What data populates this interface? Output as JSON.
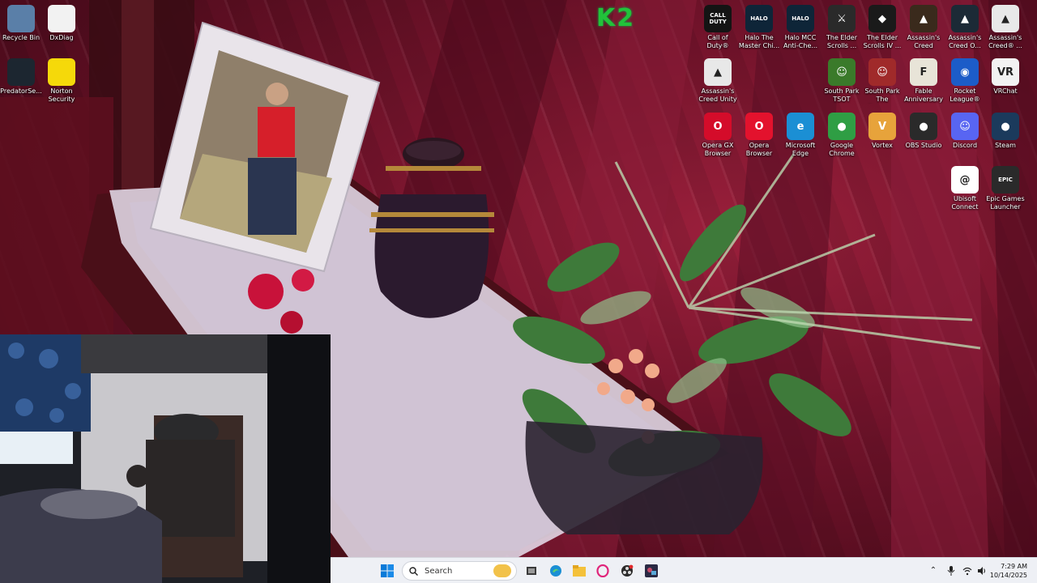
{
  "desktop": {
    "left_icons": [
      {
        "label": "Recycle Bin",
        "icon": "recycle-bin-icon",
        "color": "#5a7fa8"
      },
      {
        "label": "DxDiag",
        "icon": "document-icon",
        "color": "#f2f2f2"
      },
      {
        "label": "PredatorSe...",
        "icon": "predator-sense-icon",
        "color": "#1c2630"
      },
      {
        "label": "Norton Security Ultra",
        "icon": "norton-icon",
        "color": "#f5d90a"
      }
    ],
    "right_icons_row1": [
      {
        "label": "Call of Duty®",
        "icon": "call-of-duty-icon",
        "glyph": "CALL DUTY",
        "color": "#141414"
      },
      {
        "label": "Halo The Master Chi...",
        "icon": "halo-mcc-icon",
        "glyph": "HALO",
        "color": "#0e2538"
      },
      {
        "label": "Halo MCC Anti-Che...",
        "icon": "halo-anticheat-icon",
        "glyph": "HALO",
        "color": "#0e2538"
      },
      {
        "label": "The Elder Scrolls ...",
        "icon": "elder-scrolls-skyrim-icon",
        "glyph": "⚔",
        "color": "#2a2a2a"
      },
      {
        "label": "The Elder Scrolls IV ...",
        "icon": "elder-scrolls-oblivion-icon",
        "glyph": "◆",
        "color": "#1a1a1a"
      },
      {
        "label": "Assassin's Creed Mirage",
        "icon": "ac-mirage-icon",
        "glyph": "▲",
        "color": "#3a2a1c"
      },
      {
        "label": "Assassin's Creed O...",
        "icon": "ac-odyssey-icon",
        "glyph": "▲",
        "color": "#1c2a36"
      },
      {
        "label": "Assassin's Creed® ...",
        "icon": "ac-icon",
        "glyph": "▲",
        "color": "#e8e8e8"
      }
    ],
    "right_icons_row2": [
      {
        "label": "Assassin's Creed Unity",
        "icon": "ac-unity-icon",
        "glyph": "▲",
        "color": "#e8e8e8"
      },
      {
        "label": "South Park TSOT",
        "icon": "south-park-tsot-icon",
        "glyph": "☺",
        "color": "#3a7a2a"
      },
      {
        "label": "South Park The Fractur...",
        "icon": "south-park-fbw-icon",
        "glyph": "☺",
        "color": "#a02a2a"
      },
      {
        "label": "Fable Anniversary",
        "icon": "fable-icon",
        "glyph": "F",
        "color": "#e8e4d8"
      },
      {
        "label": "Rocket League®",
        "icon": "rocket-league-icon",
        "glyph": "◉",
        "color": "#1c5cc8"
      },
      {
        "label": "VRChat",
        "icon": "vrchat-icon",
        "glyph": "VR",
        "color": "#f2f2f2"
      }
    ],
    "right_icons_row3": [
      {
        "label": "Opera GX Browser",
        "icon": "opera-gx-icon",
        "glyph": "O",
        "color": "#d40c2a"
      },
      {
        "label": "Opera Browser",
        "icon": "opera-icon",
        "glyph": "O",
        "color": "#e3122d"
      },
      {
        "label": "Microsoft Edge",
        "icon": "edge-icon",
        "glyph": "e",
        "color": "#1b8fd4"
      },
      {
        "label": "Google Chrome",
        "icon": "chrome-icon",
        "glyph": "●",
        "color": "#2f9e44"
      },
      {
        "label": "Vortex",
        "icon": "vortex-icon",
        "glyph": "V",
        "color": "#e7a33b"
      },
      {
        "label": "OBS Studio",
        "icon": "obs-icon",
        "glyph": "●",
        "color": "#2a2a2a"
      },
      {
        "label": "Discord",
        "icon": "discord-icon",
        "glyph": "☺",
        "color": "#5865f2"
      },
      {
        "label": "Steam",
        "icon": "steam-icon",
        "glyph": "●",
        "color": "#1b3a5c"
      }
    ],
    "right_icons_row4": [
      {
        "label": "Ubisoft Connect",
        "icon": "ubisoft-icon",
        "glyph": "@",
        "color": "#ffffff"
      },
      {
        "label": "Epic Games Launcher",
        "icon": "epic-games-icon",
        "glyph": "EPIC",
        "color": "#2a2a2a"
      }
    ],
    "overlay_logo": "K2"
  },
  "taskbar": {
    "search_placeholder": "Search",
    "pinned": [
      "start-icon",
      "task-view-icon",
      "edge-icon",
      "file-explorer-icon",
      "opera-icon",
      "obs-icon",
      "game-icon"
    ],
    "clock_time": "7:29 AM",
    "clock_date": "10/14/2025"
  },
  "colors": {
    "taskbar_bg": "#eef0f5",
    "accent_blue": "#0078d4"
  }
}
